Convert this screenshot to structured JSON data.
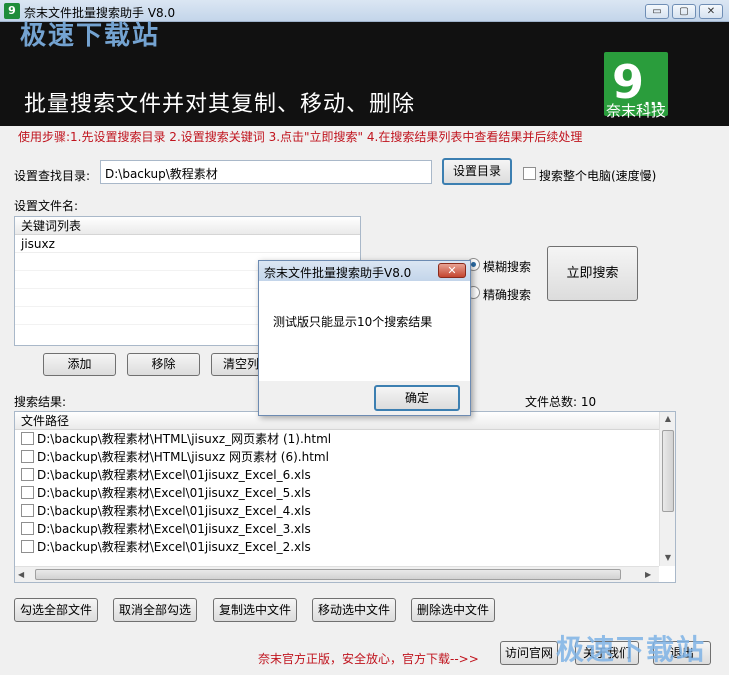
{
  "window": {
    "title": "奈末文件批量搜索助手 V8.0",
    "app_icon_glyph": "9",
    "minimize": "▭",
    "maximize": "▢",
    "close": "✕"
  },
  "banner": {
    "watermark": "极速下载站",
    "heading": "批量搜索文件并对其复制、移动、删除",
    "logo_glyph": "9",
    "logo_dots": "...",
    "logo_caption": "奈末科技",
    "background": "#111111",
    "logo_color": "#2a9d3c"
  },
  "steps": "使用步骤:1.先设置搜索目录 2.设置搜索关键词 3.点击\"立即搜索\" 4.在搜索结果列表中查看结果并后续处理",
  "directory": {
    "label": "设置查找目录:",
    "value": "D:\\backup\\教程素材",
    "set_button": "设置目录",
    "whole_pc_label": "搜索整个电脑(速度慢)"
  },
  "keywords": {
    "label": "设置文件名:",
    "column": "关键词列表",
    "items": [
      "jisuxz"
    ],
    "add_button": "添加",
    "remove_button": "移除",
    "clear_button": "清空列"
  },
  "search_mode": {
    "fuzzy": "模糊搜索",
    "exact": "精确搜索",
    "search_button": "立即搜索"
  },
  "results": {
    "label": "搜索结果:",
    "total": "文件总数: 10",
    "column": "文件路径",
    "items": [
      "D:\\backup\\教程素材\\HTML\\jisuxz_网页素材 (1).html",
      "D:\\backup\\教程素材\\HTML\\jisuxz 网页素材 (6).html",
      "D:\\backup\\教程素材\\Excel\\01jisuxz_Excel_6.xls",
      "D:\\backup\\教程素材\\Excel\\01jisuxz_Excel_5.xls",
      "D:\\backup\\教程素材\\Excel\\01jisuxz_Excel_4.xls",
      "D:\\backup\\教程素材\\Excel\\01jisuxz_Excel_3.xls",
      "D:\\backup\\教程素材\\Excel\\01jisuxz_Excel_2.xls"
    ]
  },
  "actions": {
    "select_all": "勾选全部文件",
    "deselect_all": "取消全部勾选",
    "copy": "复制选中文件",
    "move": "移动选中文件",
    "delete": "删除选中文件"
  },
  "footer": {
    "note": "奈末官方正版，安全放心，官方下载-->>",
    "visit_site": "访问官网",
    "about": "关于我们",
    "exit": "退出",
    "watermark": "极速下载站"
  },
  "dialog": {
    "title": "奈末文件批量搜索助手V8.0",
    "message": "测试版只能显示10个搜索结果",
    "ok": "确定",
    "close": "✕"
  },
  "colors": {
    "accent_red": "#c0141e",
    "watermark_blue": "#7fb3e6"
  }
}
